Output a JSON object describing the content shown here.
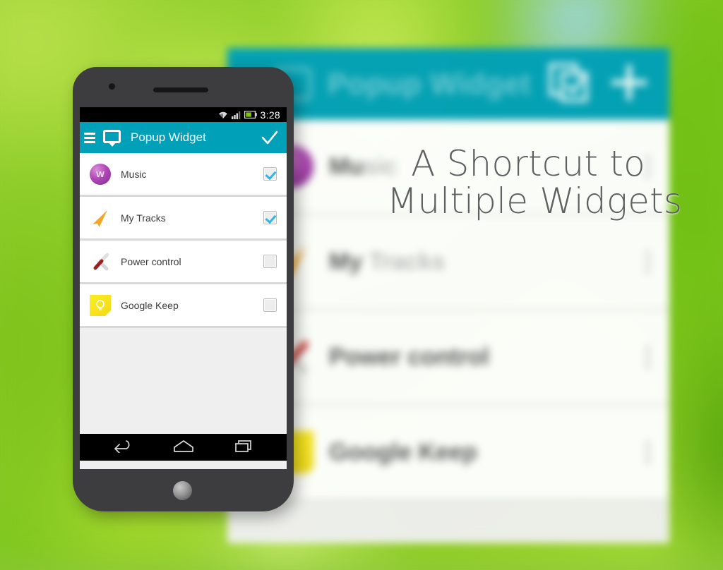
{
  "promo": {
    "headline_line1": "A Shortcut to",
    "headline_line2": "Multiple Widgets",
    "headline_color": "#5f6062"
  },
  "background_app": {
    "app_bar": {
      "title": "Popup Widget",
      "accent_color": "#00a0b8",
      "icon_name": "popup-widget-icon",
      "actions": [
        {
          "name": "duplicate-widget-icon",
          "label": "Duplicate"
        },
        {
          "name": "add-widget-icon",
          "label": "Add"
        }
      ]
    },
    "rows": [
      {
        "label_strong": "Mu",
        "label_faded": "sic",
        "icon": "music-icon"
      },
      {
        "label_strong": "My",
        "label_faded": "Tracks",
        "icon": "my-tracks-icon"
      },
      {
        "label_strong": "Power control",
        "label_faded": "",
        "icon": "power-control-icon"
      },
      {
        "label_strong": "Google Keep",
        "label_faded": "",
        "icon": "google-keep-icon"
      }
    ]
  },
  "phone": {
    "status_bar": {
      "time": "3:28",
      "icons": [
        "wifi-icon",
        "signal-icon",
        "battery-icon"
      ]
    },
    "action_bar": {
      "menu_icon": "hamburger-menu-icon",
      "app_icon": "popup-widget-icon",
      "title": "Popup Widget",
      "confirm_icon": "checkmark-icon",
      "accent_color": "#00a0b8"
    },
    "widget_list": [
      {
        "label": "Music",
        "icon": "music-icon",
        "checked": true,
        "icon_glyph": "w"
      },
      {
        "label": "My Tracks",
        "icon": "my-tracks-icon",
        "checked": true,
        "icon_glyph": ""
      },
      {
        "label": "Power control",
        "icon": "power-control-icon",
        "checked": false,
        "icon_glyph": ""
      },
      {
        "label": "Google Keep",
        "icon": "google-keep-icon",
        "checked": false,
        "icon_glyph": ""
      }
    ],
    "nav_bar": {
      "buttons": [
        {
          "name": "nav-back-button",
          "label": "Back"
        },
        {
          "name": "nav-home-button",
          "label": "Home"
        },
        {
          "name": "nav-recents-button",
          "label": "Recents"
        }
      ]
    }
  }
}
